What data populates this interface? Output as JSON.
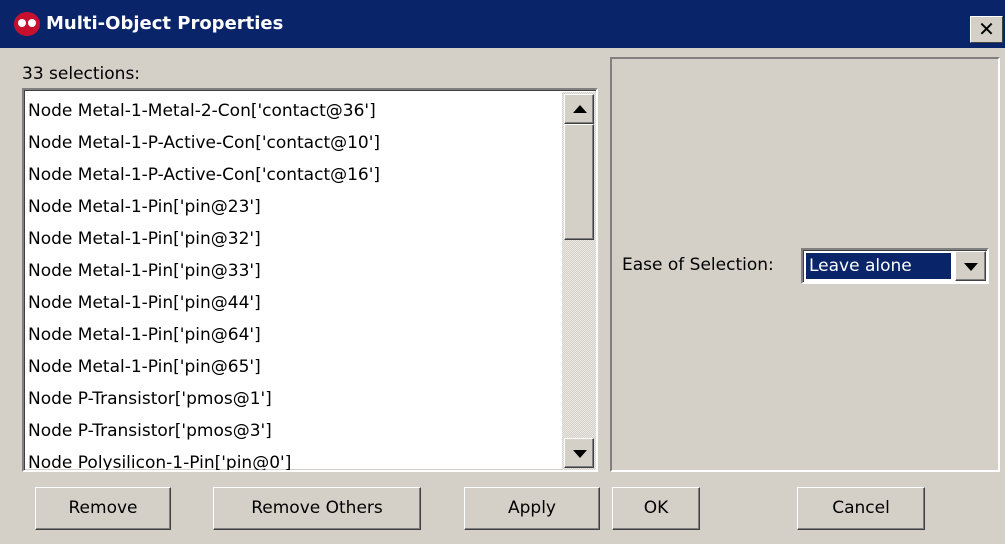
{
  "window": {
    "title": "Multi-Object Properties",
    "close_glyph": "✕",
    "app_icon": "electric-app-icon"
  },
  "selection": {
    "count_label": "33 selections:",
    "items": [
      "Node Metal-1-Metal-2-Con['contact@36']",
      "Node Metal-1-P-Active-Con['contact@10']",
      "Node Metal-1-P-Active-Con['contact@16']",
      "Node Metal-1-Pin['pin@23']",
      "Node Metal-1-Pin['pin@32']",
      "Node Metal-1-Pin['pin@33']",
      "Node Metal-1-Pin['pin@44']",
      "Node Metal-1-Pin['pin@64']",
      "Node Metal-1-Pin['pin@65']",
      "Node P-Transistor['pmos@1']",
      "Node P-Transistor['pmos@3']",
      "Node Polysilicon-1-Pin['pin@0']"
    ]
  },
  "properties": {
    "ease_label": "Ease of Selection:",
    "ease_value": "Leave alone"
  },
  "buttons": {
    "remove": "Remove",
    "remove_others": "Remove Others",
    "apply": "Apply",
    "ok": "OK",
    "cancel": "Cancel"
  },
  "colors": {
    "titlebar": "#0a246a",
    "dialog_bg": "#d4d0c8",
    "selection_highlight": "#0a246a"
  }
}
